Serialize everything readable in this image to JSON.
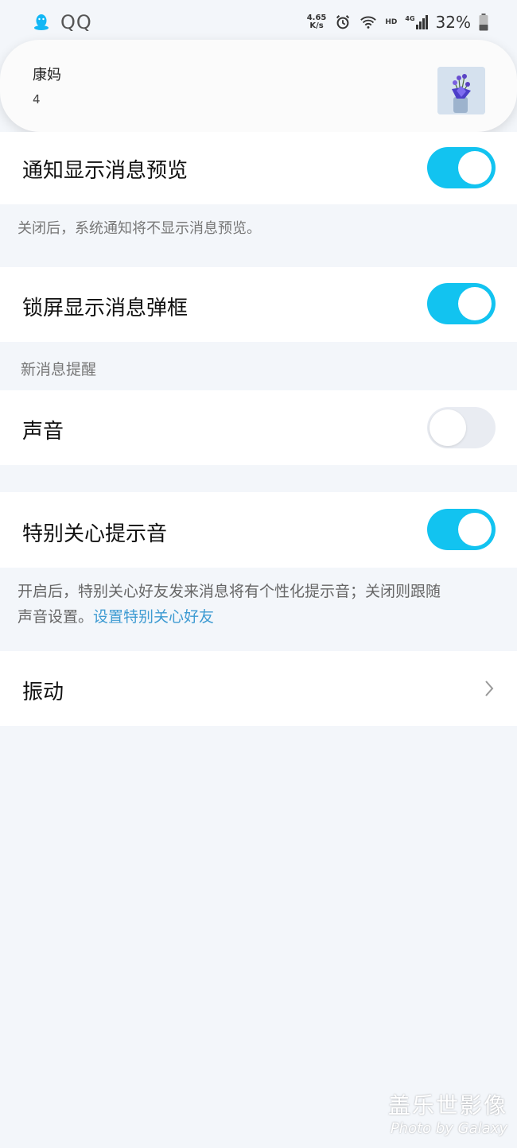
{
  "status_bar": {
    "app_name": "QQ",
    "net_speed_value": "4.65",
    "net_speed_unit": "K/s",
    "hd_label": "HD",
    "network_label": "4G",
    "battery": "32%"
  },
  "notification": {
    "title": "康妈",
    "count": "4"
  },
  "settings": {
    "preview": {
      "label": "通知显示消息预览",
      "enabled": true
    },
    "preview_hint": "关闭后，系统通知将不显示消息预览。",
    "lockscreen": {
      "label": "锁屏显示消息弹框",
      "enabled": true
    },
    "section_new_message": "新消息提醒",
    "sound": {
      "label": "声音",
      "enabled": false
    },
    "special_care": {
      "label": "特别关心提示音",
      "enabled": true
    },
    "special_hint_line1": "开启后，特别关心好友发来消息将有个性化提示音；关闭则跟随",
    "special_hint_line2": "声音设置。",
    "special_hint_link": "设置特别关心好友",
    "vibration": {
      "label": "振动"
    }
  },
  "watermark": {
    "line1": "盖乐世影像",
    "line2": "Photo by Galaxy"
  },
  "colors": {
    "accent": "#12c3f0",
    "link": "#3e9bd2",
    "background": "#f3f6fa"
  }
}
